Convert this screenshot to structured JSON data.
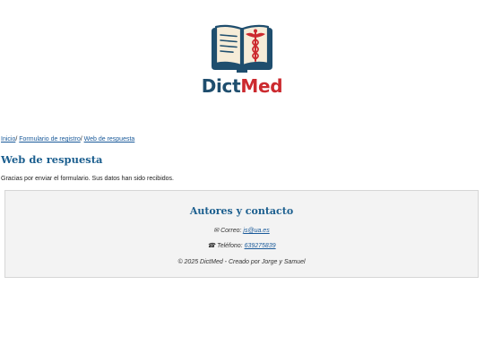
{
  "header": {
    "logo_part1": "Dict",
    "logo_part2": "Med",
    "colors": {
      "dict": "#1f4e6e",
      "med": "#cc2a2f"
    },
    "logo_icon": "book-caduceus-icon"
  },
  "breadcrumb": {
    "items": [
      {
        "label": "Inicio"
      },
      {
        "label": "Formulario de registro"
      },
      {
        "label": "Web de respuesta"
      }
    ],
    "separator": "/"
  },
  "main": {
    "title": "Web de respuesta",
    "message": "Gracias por enviar el formulario. Sus datos han sido recibidos."
  },
  "footer": {
    "title": "Autores y contacto",
    "email_prefix": "Correo:",
    "email": "js@ua.es",
    "email_icon": "envelope-icon",
    "phone_prefix": "Teléfono:",
    "phone": "639275839",
    "phone_icon": "phone-icon",
    "copyright": "© 2025 DictMed - Creado por Jorge y Samuel"
  }
}
